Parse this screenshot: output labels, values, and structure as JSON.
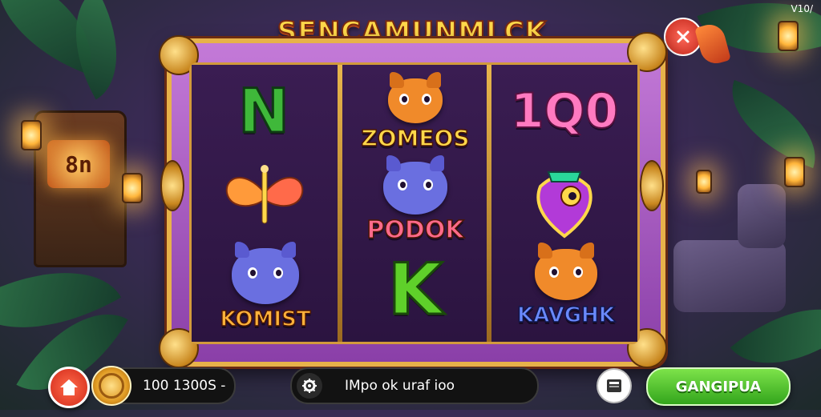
{
  "game": {
    "title": "SENCAMUNMLCK",
    "version": "V10/"
  },
  "reels": [
    [
      {
        "type": "letter",
        "text": "N",
        "color": "#3fb83a"
      },
      {
        "type": "butterfly"
      },
      {
        "type": "creature",
        "label": "KOMIST",
        "face_color": "#6a6fe0"
      }
    ],
    [
      {
        "type": "creature",
        "label": "ZOMEOS",
        "face_color": "#f08a2a"
      },
      {
        "type": "creature",
        "label": "PODOK",
        "face_color": "#6a6fe0"
      },
      {
        "type": "letter",
        "text": "K",
        "color": "#5fd02a"
      }
    ],
    [
      {
        "type": "number",
        "text": "1Q0"
      },
      {
        "type": "gem"
      },
      {
        "type": "creature",
        "label": "KAVGHK",
        "face_color": "#f08a2a"
      }
    ]
  ],
  "bottom_bar": {
    "balance_text": "100 1300S -",
    "message": "IMpo ok uraf ioo",
    "spin_label": "GANGIPUA"
  },
  "colors": {
    "accent": "#e7b24a",
    "spin": "#4cc32a",
    "home": "#e2462f"
  },
  "icons": {
    "home": "home-icon",
    "coin": "coin-icon",
    "settings": "gear-icon",
    "menu": "menu-icon",
    "close": "close-icon"
  }
}
